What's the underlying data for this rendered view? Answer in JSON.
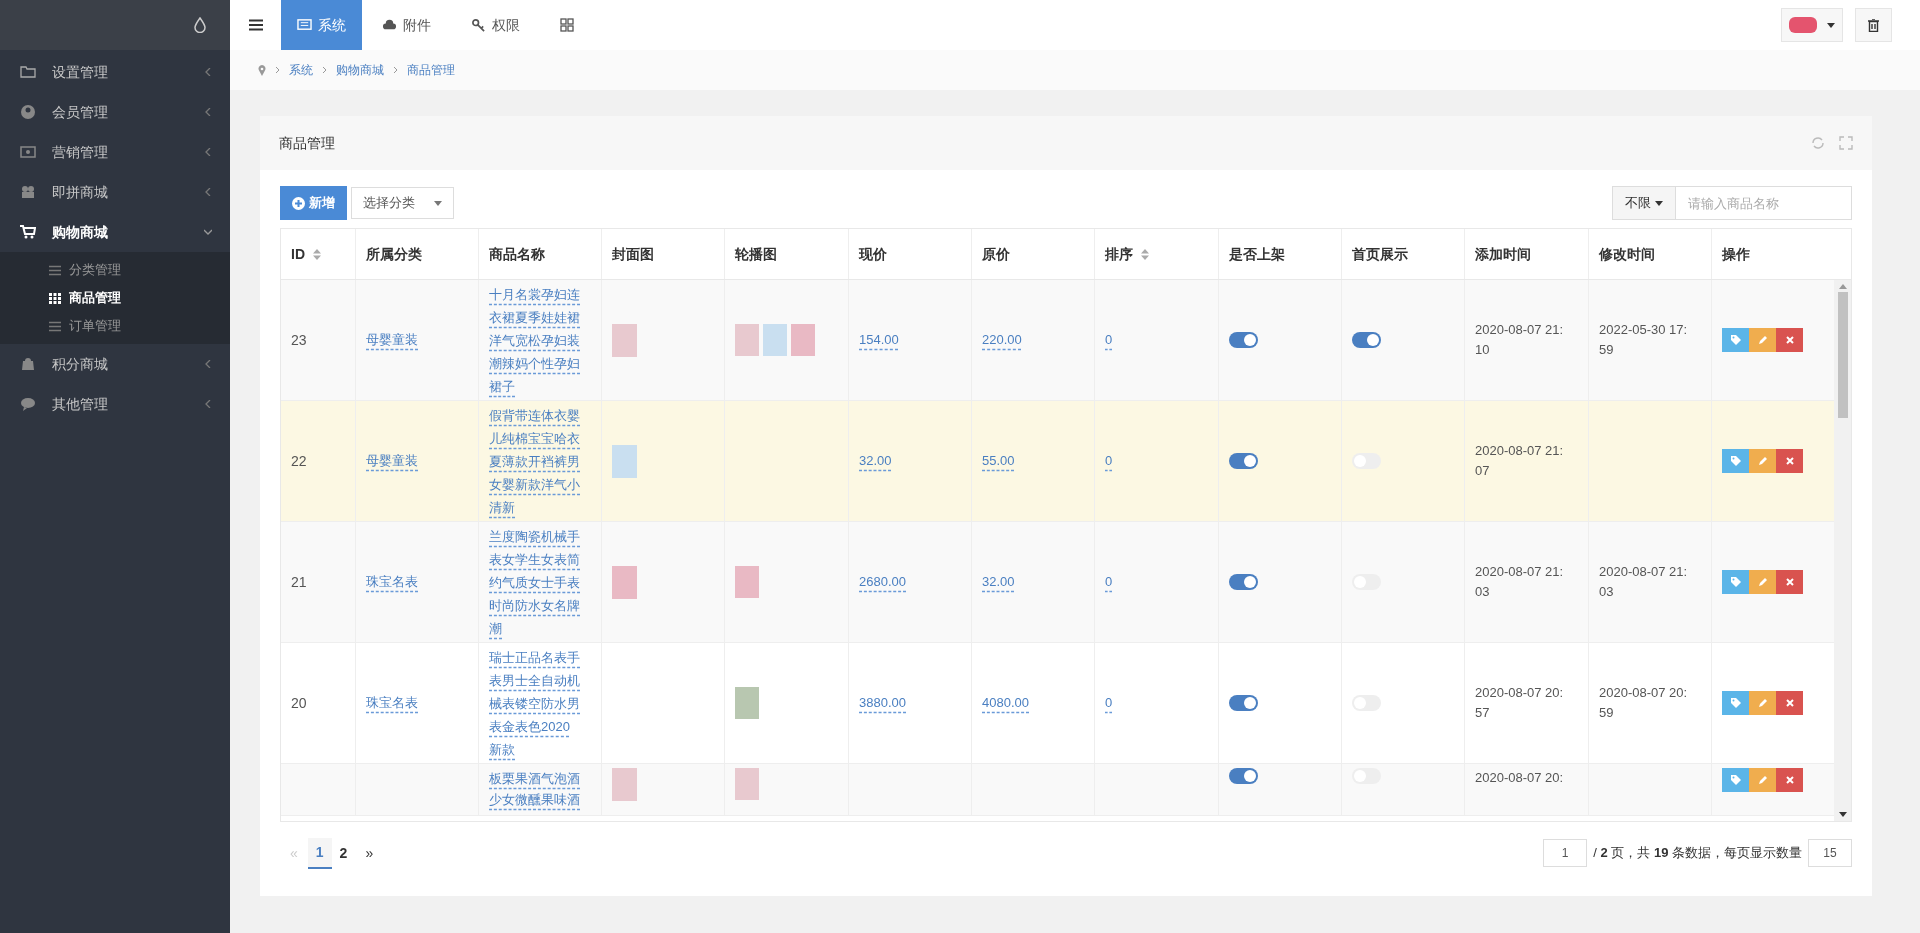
{
  "sidebar": {
    "items": [
      {
        "label": "设置管理",
        "expanded": false,
        "selected": false
      },
      {
        "label": "会员管理",
        "expanded": false,
        "selected": false
      },
      {
        "label": "营销管理",
        "expanded": false,
        "selected": false
      },
      {
        "label": "即拼商城",
        "expanded": false,
        "selected": false
      },
      {
        "label": "购物商城",
        "expanded": true,
        "selected": true,
        "children": [
          {
            "label": "分类管理",
            "selected": false
          },
          {
            "label": "商品管理",
            "selected": true
          },
          {
            "label": "订单管理",
            "selected": false
          }
        ]
      },
      {
        "label": "积分商城",
        "expanded": false,
        "selected": false
      },
      {
        "label": "其他管理",
        "expanded": false,
        "selected": false
      }
    ]
  },
  "top_tabs": [
    {
      "label": "系统",
      "selected": true
    },
    {
      "label": "附件",
      "selected": false
    },
    {
      "label": "权限",
      "selected": false
    }
  ],
  "breadcrumb": [
    "系统",
    "购物商城",
    "商品管理"
  ],
  "panel": {
    "title": "商品管理",
    "toolbar": {
      "add_button": "新增",
      "category_select": "选择分类",
      "filter_dropdown": "不限",
      "search": {
        "placeholder": "请输入商品名称"
      }
    },
    "table": {
      "columns": [
        {
          "label": "ID",
          "sortable": true
        },
        {
          "label": "所属分类",
          "sortable": false
        },
        {
          "label": "商品名称",
          "sortable": false
        },
        {
          "label": "封面图",
          "sortable": false
        },
        {
          "label": "轮播图",
          "sortable": false
        },
        {
          "label": "现价",
          "sortable": false
        },
        {
          "label": "原价",
          "sortable": false
        },
        {
          "label": "排序",
          "sortable": true
        },
        {
          "label": "是否上架",
          "sortable": false
        },
        {
          "label": "首页展示",
          "sortable": false
        },
        {
          "label": "添加时间",
          "sortable": false
        },
        {
          "label": "修改时间",
          "sortable": false
        },
        {
          "label": "操作",
          "sortable": false
        }
      ],
      "rows": [
        {
          "id": "23",
          "category": "母婴童装",
          "name": [
            "十月名裳孕妇连",
            "衣裙夏季娃娃裙",
            "洋气宽松孕妇装",
            "潮辣妈个性孕妇",
            "裙子"
          ],
          "cover": true,
          "price": "154.00",
          "original_price": "220.00",
          "sort": "0",
          "on_sale": true,
          "home_show": true,
          "add_time": [
            "2020-08-07 21:",
            "10"
          ],
          "update_time": [
            "2022-05-30 17:",
            "59"
          ],
          "selected": false
        },
        {
          "id": "22",
          "category": "母婴童装",
          "name": [
            "假背带连体衣婴",
            "儿纯棉宝宝哈衣",
            "夏薄款开裆裤男",
            "女婴新款洋气小",
            "清新"
          ],
          "cover": true,
          "price": "32.00",
          "original_price": "55.00",
          "sort": "0",
          "on_sale": true,
          "home_show": false,
          "add_time": [
            "2020-08-07 21:",
            "07"
          ],
          "selected": true
        },
        {
          "id": "21",
          "category": "珠宝名表",
          "name": [
            "兰度陶瓷机械手",
            "表女学生女表简",
            "约气质女士手表",
            "时尚防水女名牌",
            "潮"
          ],
          "cover": true,
          "price": "2680.00",
          "original_price": "32.00",
          "sort": "0",
          "on_sale": true,
          "home_show": false,
          "add_time": [
            "2020-08-07 21:",
            "03"
          ],
          "update_time": [
            "2020-08-07 21:",
            "03"
          ],
          "selected": false
        },
        {
          "id": "20",
          "category": "珠宝名表",
          "name": [
            "瑞士正品名表手",
            "表男士全自动机",
            "械表镂空防水男",
            "表金表色2020",
            "新款"
          ],
          "cover": false,
          "price": "3880.00",
          "original_price": "4080.00",
          "sort": "0",
          "on_sale": true,
          "home_show": false,
          "add_time": [
            "2020-08-07 20:",
            "57"
          ],
          "update_time": [
            "2020-08-07 20:",
            "59"
          ],
          "selected": false
        },
        {
          "partial": true,
          "name": [
            "板栗果酒气泡酒",
            "少女微醺果味酒"
          ],
          "cover": true,
          "on_sale": true,
          "home_show": false,
          "add_time": [
            "2020-08-07 20:"
          ],
          "selected": false
        }
      ]
    },
    "pagination": {
      "prev": "«",
      "pages": [
        {
          "label": "1",
          "selected": true
        },
        {
          "label": "2",
          "selected": false
        }
      ],
      "next": "»",
      "page_input": "1",
      "summary": "/ **2** 页，共 **19** 条数据，每页显示数量",
      "page_size": "15"
    }
  }
}
